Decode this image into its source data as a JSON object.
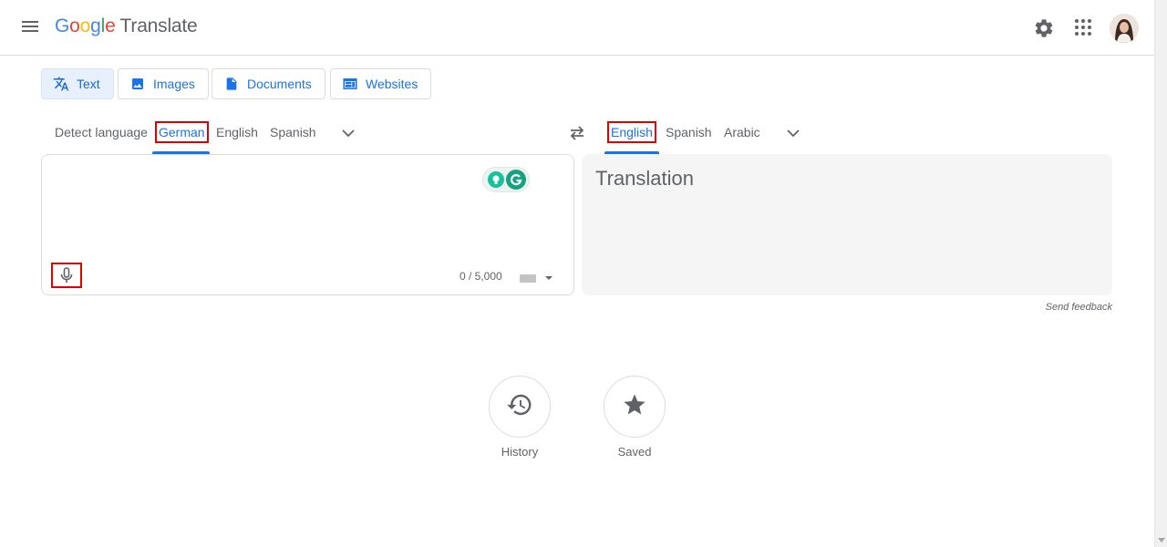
{
  "header": {
    "logo_letters": [
      "G",
      "o",
      "o",
      "g",
      "l",
      "e"
    ],
    "product": "Translate",
    "icons": [
      "menu-icon",
      "gear-icon",
      "apps-grid-icon",
      "avatar"
    ]
  },
  "modes": [
    {
      "label": "Text",
      "icon": "translate-icon",
      "active": true
    },
    {
      "label": "Images",
      "icon": "image-icon",
      "active": false
    },
    {
      "label": "Documents",
      "icon": "document-icon",
      "active": false
    },
    {
      "label": "Websites",
      "icon": "web-icon",
      "active": false
    }
  ],
  "source_langs": {
    "detect": "Detect language",
    "selected": "German",
    "others": [
      "English",
      "Spanish"
    ]
  },
  "target_langs": {
    "selected": "English",
    "others": [
      "Spanish",
      "Arabic"
    ]
  },
  "source": {
    "value": "",
    "char_count": "0 / 5,000"
  },
  "target": {
    "placeholder": "Translation",
    "feedback": "Send feedback"
  },
  "bottom": {
    "history": "History",
    "saved": "Saved"
  },
  "colors": {
    "accent": "#1a73e8",
    "highlight_box": "#e00000",
    "grammarly": "#15a37f"
  }
}
